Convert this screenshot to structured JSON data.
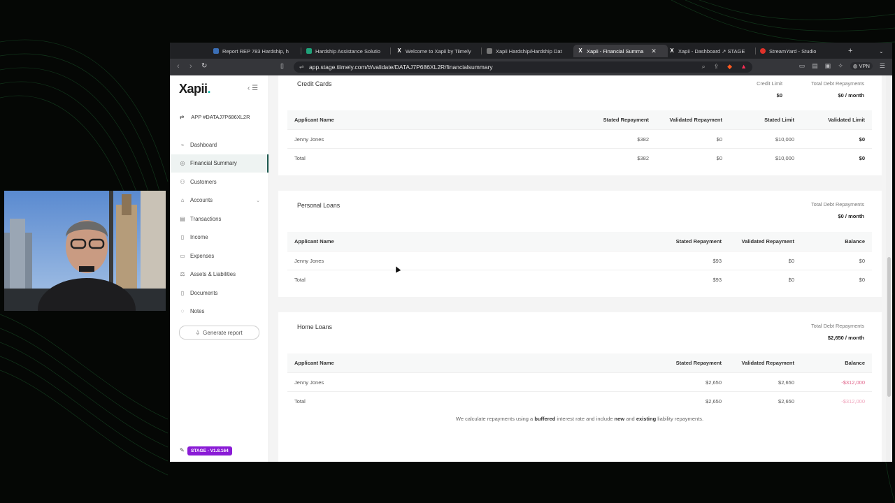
{
  "browser": {
    "tabs": [
      {
        "label": "Report REP 783 Hardship, h",
        "icon": "report-icon"
      },
      {
        "label": "Hardship Assistance Solutio",
        "icon": "hardship-icon"
      },
      {
        "label": "Welcome to Xapii by Tiimely",
        "icon": "x-icon"
      },
      {
        "label": "Xapii Hardship/Hardship Dat",
        "icon": "doc-icon"
      },
      {
        "label": "Xapii - Financial Summa",
        "icon": "x-icon",
        "active": true
      },
      {
        "label": "Xapii - Dashboard ↗ STAGE",
        "icon": "x-icon"
      },
      {
        "label": "StreamYard - Studio",
        "icon": "streamyard-icon"
      }
    ],
    "url": "app.stage.tiimely.com/#/validate/DATAJ7P686XL2R/financialsummary",
    "vpn_label": "VPN"
  },
  "sidebar": {
    "logo": "Xapii",
    "app_id": "APP #DATAJ7P686XL2R",
    "nav": [
      {
        "label": "Dashboard",
        "icon": "dashboard-icon"
      },
      {
        "label": "Financial Summary",
        "icon": "financial-summary-icon",
        "active": true
      },
      {
        "label": "Customers",
        "icon": "customers-icon"
      },
      {
        "label": "Accounts",
        "icon": "accounts-icon",
        "expandable": true
      },
      {
        "label": "Transactions",
        "icon": "transactions-icon"
      },
      {
        "label": "Income",
        "icon": "income-icon"
      },
      {
        "label": "Expenses",
        "icon": "expenses-icon"
      },
      {
        "label": "Assets & Liabilities",
        "icon": "assets-liabilities-icon"
      },
      {
        "label": "Documents",
        "icon": "documents-icon"
      },
      {
        "label": "Notes",
        "icon": "notes-icon"
      }
    ],
    "generate_report": "Generate report",
    "stage_badge": "STAGE - V1.8.164"
  },
  "credit_cards": {
    "title": "Credit Cards",
    "credit_limit_label": "Credit Limit",
    "credit_limit_value": "$0",
    "total_debt_label": "Total Debt Repayments",
    "total_debt_value": "$0 / month",
    "headers": [
      "Applicant Name",
      "Stated Repayment",
      "Validated Repayment",
      "Stated Limit",
      "Validated Limit"
    ],
    "rows": [
      [
        "Jenny Jones",
        "$382",
        "$0",
        "$10,000",
        "$0"
      ],
      [
        "Total",
        "$382",
        "$0",
        "$10,000",
        "$0"
      ]
    ]
  },
  "personal_loans": {
    "title": "Personal Loans",
    "total_debt_label": "Total Debt Repayments",
    "total_debt_value": "$0 / month",
    "headers": [
      "Applicant Name",
      "Stated Repayment",
      "Validated Repayment",
      "Balance"
    ],
    "rows": [
      [
        "Jenny Jones",
        "$93",
        "$0",
        "$0"
      ],
      [
        "Total",
        "$93",
        "$0",
        "$0"
      ]
    ]
  },
  "home_loans": {
    "title": "Home Loans",
    "total_debt_label": "Total Debt Repayments",
    "total_debt_value": "$2,650 / month",
    "headers": [
      "Applicant Name",
      "Stated Repayment",
      "Validated Repayment",
      "Balance"
    ],
    "rows": [
      [
        "Jenny Jones",
        "$2,650",
        "$2,650",
        "-$312,000"
      ],
      [
        "Total",
        "$2,650",
        "$2,650",
        "-$312,000"
      ]
    ]
  },
  "note": {
    "p1": "We calculate repayments using a ",
    "b1": "buffered",
    "p2": " interest rate and include ",
    "b2": "new",
    "p3": " and ",
    "b3": "existing",
    "p4": " liability repayments."
  },
  "colors": {
    "accent": "#1e5a50",
    "stage_badge": "#8a1bd6",
    "negative": "#e0648a",
    "logo_dot": "#13b9a8"
  }
}
